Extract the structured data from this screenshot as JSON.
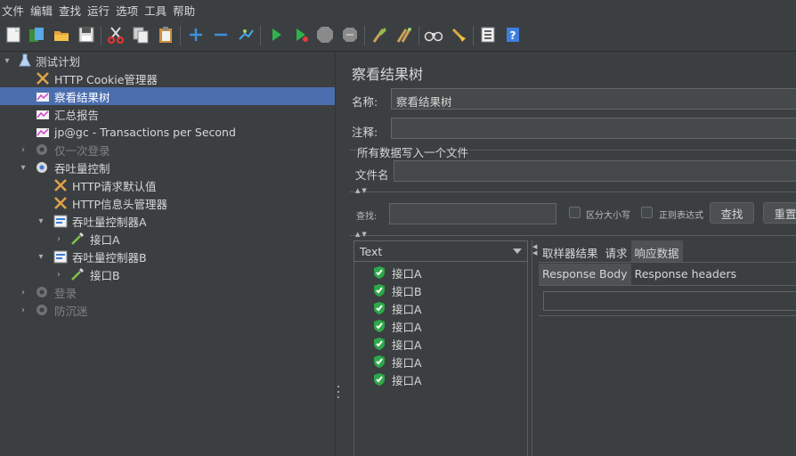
{
  "menu": [
    "文件",
    "编辑",
    "查找",
    "运行",
    "选项",
    "工具",
    "帮助"
  ],
  "toolbar": {
    "icons": [
      "new-icon",
      "templates-icon",
      "open-icon",
      "save-icon",
      "cut-icon",
      "copy-icon",
      "paste-icon",
      "expand-icon",
      "collapse-icon",
      "toggle-icon",
      "start-icon",
      "start-no-pause-icon",
      "stop-icon",
      "shutdown-icon",
      "clear-icon",
      "clear-all-icon",
      "search-icon",
      "reset-search-icon",
      "function-helper-icon",
      "help-icon"
    ]
  },
  "tree": {
    "items": [
      {
        "label": "测试计划",
        "icon": "testplan-icon",
        "state": "normal"
      },
      {
        "label": "HTTP Cookie管理器",
        "icon": "config-tool-icon",
        "state": "normal"
      },
      {
        "label": "察看结果树",
        "icon": "listener-graph-icon",
        "state": "selected"
      },
      {
        "label": "汇总报告",
        "icon": "listener-graph-icon",
        "state": "normal"
      },
      {
        "label": "jp@gc - Transactions per Second",
        "icon": "listener-graph-icon",
        "state": "normal"
      },
      {
        "label": "仅一次登录",
        "icon": "gear-icon",
        "state": "disabled"
      },
      {
        "label": "吞吐量控制",
        "icon": "gear-icon",
        "state": "normal"
      },
      {
        "label": "HTTP请求默认值",
        "icon": "config-tool-icon",
        "state": "normal"
      },
      {
        "label": "HTTP信息头管理器",
        "icon": "config-tool-icon",
        "state": "normal"
      },
      {
        "label": "吞吐量控制器A",
        "icon": "controller-icon",
        "state": "normal"
      },
      {
        "label": "接口A",
        "icon": "sampler-pipette-icon",
        "state": "normal"
      },
      {
        "label": "吞吐量控制器B",
        "icon": "controller-icon",
        "state": "normal"
      },
      {
        "label": "接口B",
        "icon": "sampler-pipette-icon",
        "state": "normal"
      },
      {
        "label": "登录",
        "icon": "gear-icon",
        "state": "disabled"
      },
      {
        "label": "防沉迷",
        "icon": "gear-icon",
        "state": "disabled"
      }
    ]
  },
  "panel": {
    "title": "察看结果树",
    "name_label": "名称:",
    "name_value": "察看结果树",
    "comment_label": "注释:",
    "comment_value": "",
    "file_group_label": "所有数据写入一个文件",
    "filename_label": "文件名",
    "filename_value": ""
  },
  "search": {
    "label": "查找:",
    "value": "",
    "case_sensitive_label": "区分大小写",
    "regex_label": "正则表达式",
    "find_button": "查找",
    "reset_button": "重置"
  },
  "renderer": {
    "selected": "Text"
  },
  "results": [
    "接口A",
    "接口B",
    "接口A",
    "接口A",
    "接口A",
    "接口A",
    "接口A"
  ],
  "result_tabs": {
    "tabs": [
      "取样器结果",
      "请求",
      "响应数据"
    ],
    "active": "响应数据",
    "subtabs": [
      "Response Body",
      "Response headers"
    ],
    "active_subtab": "Response Body"
  },
  "colors": {
    "background": "#3c3f41",
    "selection": "#4b6eaf",
    "success_green": "#2ea84a"
  }
}
